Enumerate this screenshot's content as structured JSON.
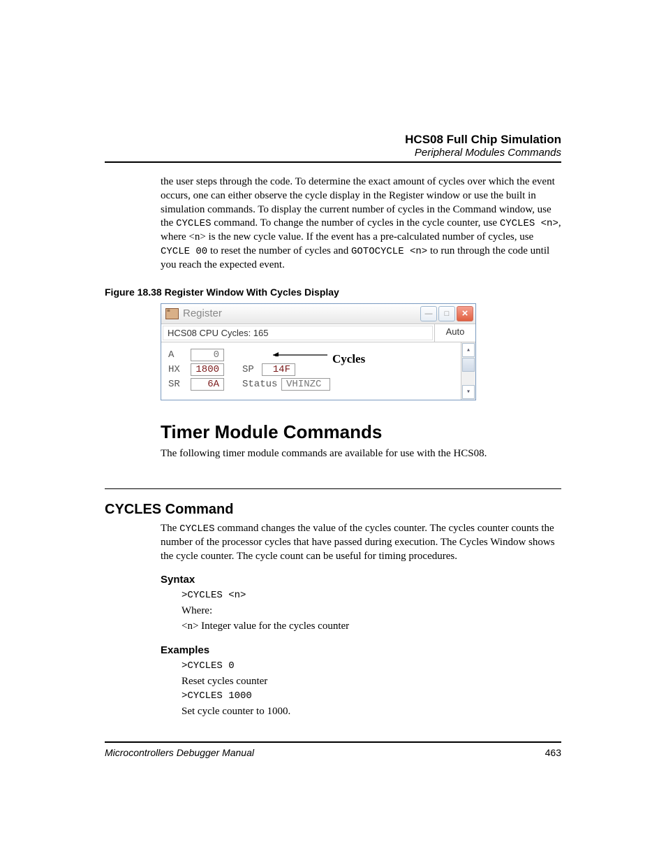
{
  "header": {
    "title": "HCS08 Full Chip Simulation",
    "subtitle": "Peripheral Modules Commands"
  },
  "intro": {
    "p1a": "the user steps through the code. To determine the exact amount of cycles over which the event occurs, one can either observe the cycle display in the Register window or use the built in simulation commands. To display the current number of cycles in the Command window, use the ",
    "cmd1": "CYCLES",
    "p1b": " command. To change the number of cycles in the cycle counter, use ",
    "cmd2": "CYCLES <n>",
    "p1c": ", where <n> is the new cycle value. If the event has a pre-calculated number of cycles, use ",
    "cmd3": "CYCLE 00",
    "p1d": " to reset the number of cycles and ",
    "cmd4": "GOTOCYCLE <n>",
    "p1e": " to run through the code until you reach the expected event."
  },
  "figure": {
    "caption": "Figure 18.38  Register Window With Cycles Display",
    "window_title": "Register",
    "info_left": "HCS08   CPU Cycles: 165",
    "info_right": "Auto",
    "regs": {
      "A_label": "A",
      "A_val": "0",
      "HX_label": "HX",
      "HX_val": "1800",
      "SP_label": "SP",
      "SP_val": "14F",
      "SR_label": "SR",
      "SR_val": "6A",
      "Status_label": "Status",
      "Status_val": "VHINZC"
    },
    "callout": "Cycles"
  },
  "section1": {
    "title": "Timer Module Commands",
    "body": "The following timer module commands are available for use with the HCS08."
  },
  "section2": {
    "title": "CYCLES Command",
    "body_a": "The ",
    "body_cmd": "CYCLES",
    "body_b": " command changes the value of the cycles counter. The cycles counter counts the number of the processor cycles that have passed during execution. The Cycles Window shows the cycle counter. The cycle count can be useful for timing procedures.",
    "syntax_label": "Syntax",
    "syntax1": ">CYCLES <n>",
    "syntax2": "Where:",
    "syntax3": "<n> Integer value for the cycles counter",
    "examples_label": "Examples",
    "ex1": ">CYCLES 0",
    "ex2": "Reset cycles counter",
    "ex3": ">CYCLES 1000",
    "ex4": "Set cycle counter to 1000."
  },
  "footer": {
    "left": "Microcontrollers Debugger Manual",
    "right": "463"
  }
}
